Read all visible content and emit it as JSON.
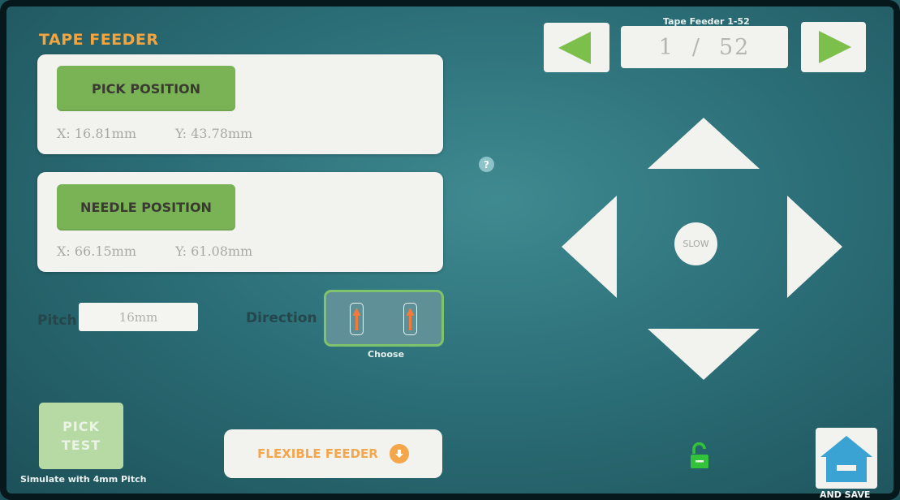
{
  "title": "TAPE FEEDER",
  "pick": {
    "button_label": "PICK POSITION",
    "x_label": "X:",
    "x_value": "16.81mm",
    "y_label": "Y:",
    "y_value": "43.78mm"
  },
  "needle": {
    "button_label": "NEEDLE POSITION",
    "x_label": "X:",
    "x_value": "66.15mm",
    "y_label": "Y:",
    "y_value": "61.08mm"
  },
  "pitch": {
    "label": "Pitch",
    "value": "16mm"
  },
  "direction": {
    "label": "Direction",
    "choose_label": "Choose"
  },
  "pick_test": {
    "line1": "PICK",
    "line2": "TEST",
    "caption": "Simulate with 4mm Pitch"
  },
  "flexible_feeder": {
    "label": "FLEXIBLE FEEDER"
  },
  "help": {
    "symbol": "?"
  },
  "feeder_nav": {
    "label": "Tape Feeder 1-52",
    "current": "1",
    "separator": "/",
    "total": "52"
  },
  "jog": {
    "slow_label": "SLOW"
  },
  "save": {
    "label": "AND SAVE"
  },
  "icons": [
    "prev-arrow-icon",
    "next-arrow-icon",
    "up-arrow-icon",
    "down-arrow-icon",
    "left-arrow-icon",
    "right-arrow-icon",
    "unlock-icon",
    "home-icon",
    "orange-arrow-icon",
    "circle-down-arrow-icon"
  ],
  "colors": {
    "accent_green": "#79b355",
    "accent_orange": "#f3a43f",
    "panel": "#f2f2ee",
    "lock_green": "#33c33a"
  }
}
